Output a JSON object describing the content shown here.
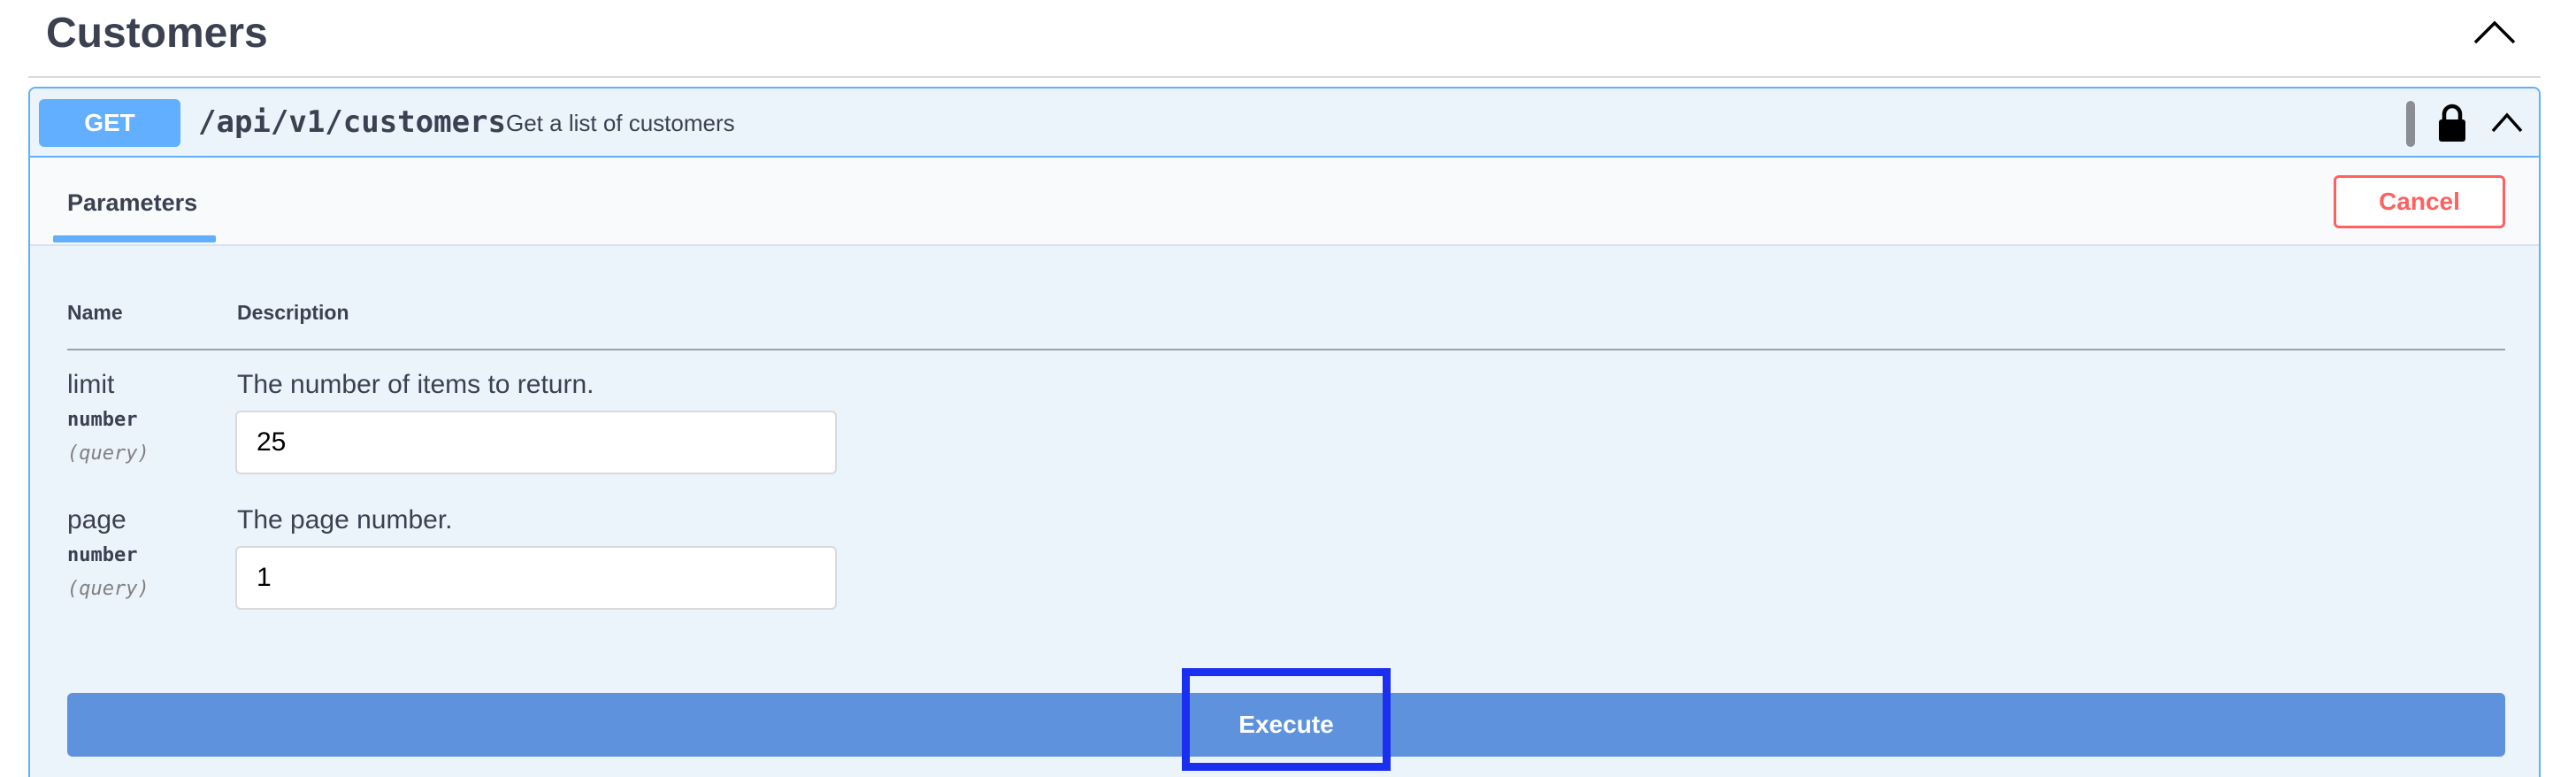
{
  "section": {
    "title": "Customers",
    "toggle_icon": "chevron-up-icon"
  },
  "operation": {
    "method": "GET",
    "path": "/api/v1/customers",
    "summary": "Get a list of customers",
    "lock_icon": "lock-icon",
    "collapse_icon": "chevron-up-icon",
    "method_color": "#61affe"
  },
  "tabs": {
    "parameters_label": "Parameters",
    "cancel_label": "Cancel",
    "cancel_color": "#ff6060"
  },
  "table": {
    "name_header": "Name",
    "description_header": "Description",
    "params": [
      {
        "name": "limit",
        "type": "number",
        "in": "(query)",
        "description": "The number of items to return.",
        "value": "25"
      },
      {
        "name": "page",
        "type": "number",
        "in": "(query)",
        "description": "The page number.",
        "value": "1"
      }
    ]
  },
  "execute": {
    "label": "Execute",
    "color": "#5f92dc",
    "highlight_color": "#1a2ff0"
  }
}
